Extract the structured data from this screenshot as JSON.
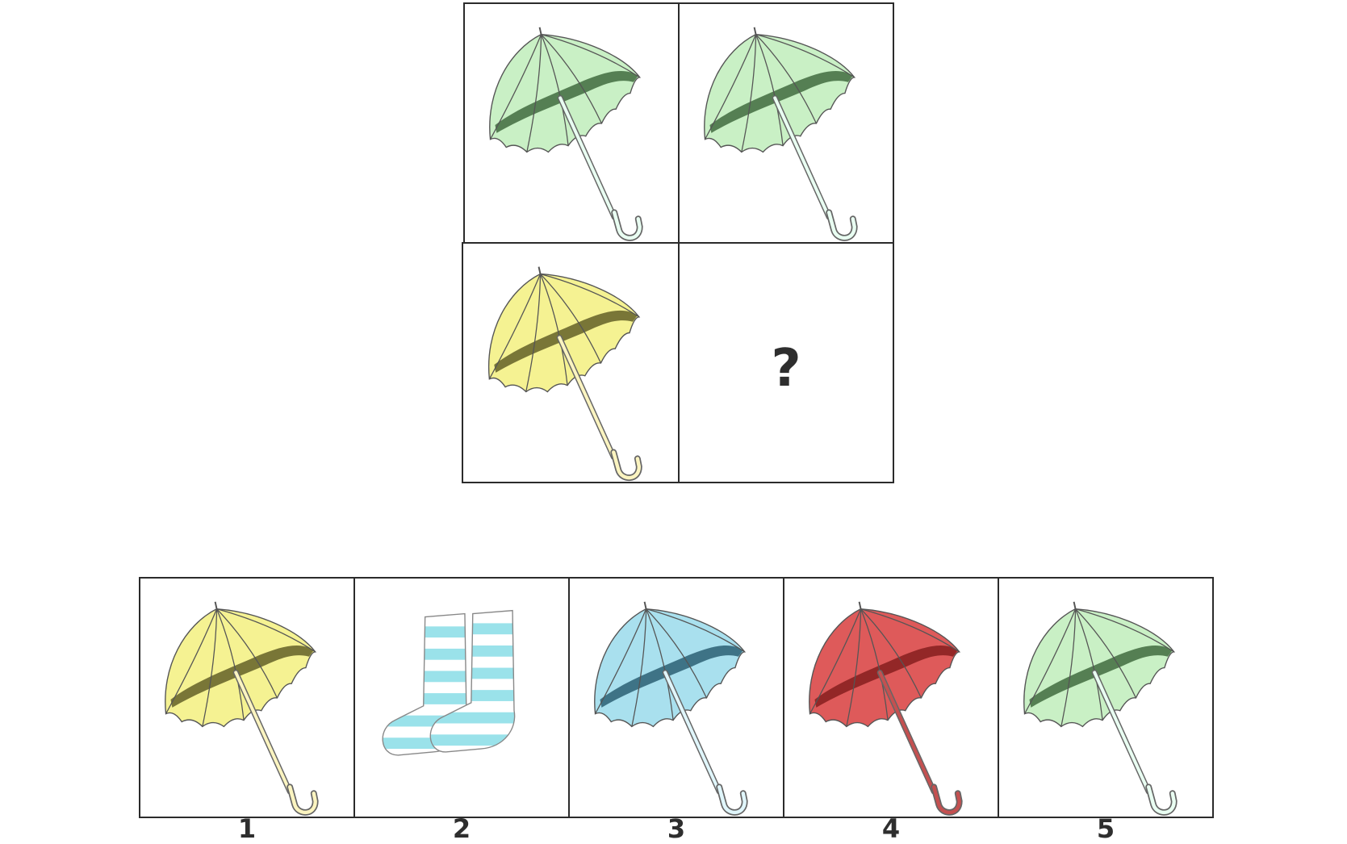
{
  "puzzle": {
    "question_mark": "?",
    "grid": [
      {
        "item": "umbrella",
        "fill": "#c9f0c5",
        "shade": "#2e5a2c",
        "handle": "#e9fff2"
      },
      {
        "item": "umbrella",
        "fill": "#c9f0c5",
        "shade": "#2e5a2c",
        "handle": "#e9fff2"
      },
      {
        "item": "umbrella",
        "fill": "#f5f292",
        "shade": "#4f4c18",
        "handle": "#fbf4c0"
      },
      {
        "item": "blank"
      }
    ]
  },
  "options": [
    {
      "label": "1",
      "item": "umbrella",
      "fill": "#f5f292",
      "shade": "#4f4c18",
      "handle": "#fbf4c0"
    },
    {
      "label": "2",
      "item": "socks",
      "fill": "#c7f1f4",
      "shade": "#9ae2ea"
    },
    {
      "label": "3",
      "item": "umbrella",
      "fill": "#a9e0ee",
      "shade": "#1b4f63",
      "handle": "#e0f6fb"
    },
    {
      "label": "4",
      "item": "umbrella",
      "fill": "#de5a5a",
      "shade": "#7a1717",
      "handle": "#c45050"
    },
    {
      "label": "5",
      "item": "umbrella",
      "fill": "#c9f0c5",
      "shade": "#2e5a2c",
      "handle": "#e9fff2"
    }
  ]
}
